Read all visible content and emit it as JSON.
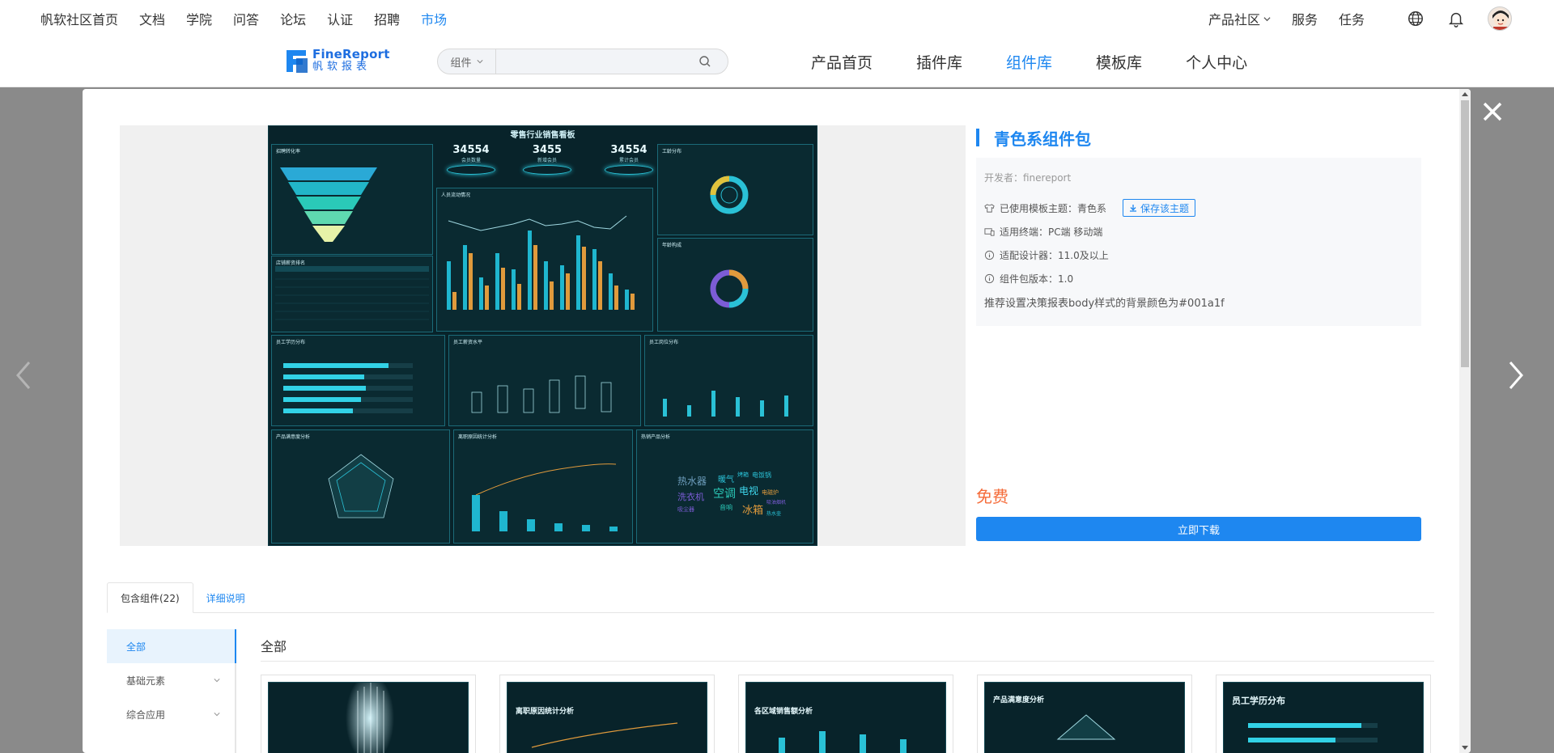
{
  "topnav": {
    "links": [
      "帆软社区首页",
      "文档",
      "学院",
      "问答",
      "论坛",
      "认证",
      "招聘",
      "市场"
    ],
    "right": {
      "community": "产品社区",
      "service": "服务",
      "task": "任务"
    }
  },
  "logo": {
    "en": "FineReport",
    "cn": "帆软报表"
  },
  "search": {
    "category": "组件",
    "placeholder": ""
  },
  "subnav": [
    "产品首页",
    "插件库",
    "组件库",
    "模板库",
    "个人中心"
  ],
  "preview": {
    "dash_title": "零售行业销售看板",
    "kpis": [
      {
        "num": "34554",
        "label": "会员数量"
      },
      {
        "num": "3455",
        "label": "新增会员"
      },
      {
        "num": "34554",
        "label": "累计会员"
      }
    ],
    "panels": [
      "招聘转化率",
      "人员流动情况",
      "工龄分布",
      "店铺薪资排名",
      "年龄构成",
      "员工学历分布",
      "员工薪资水平",
      "员工岗位分布",
      "产品满意度分析",
      "离职原因统计分析",
      "热销产品分析"
    ],
    "wordcloud": [
      "热水器",
      "暖气",
      "烤箱",
      "电饭锅",
      "洗衣机",
      "空调",
      "电视",
      "电磁炉",
      "冰箱",
      "音响",
      "吸尘器",
      "吸油烟机",
      "热水壶"
    ]
  },
  "info": {
    "title": "青色系组件包",
    "developer": "开发者：finereport",
    "theme": "已使用模板主题：青色系",
    "save_theme": "保存该主题",
    "terminal": "适用终端：PC端   移动端",
    "designer": "适配设计器：11.0及以上",
    "version": "组件包版本：1.0",
    "recommend": "推荐设置决策报表body样式的背景颜色为#001a1f",
    "price": "免费",
    "download": "立即下载"
  },
  "tabs": {
    "components": "包含组件(22)",
    "details": "详细说明"
  },
  "sidebar": {
    "all": "全部",
    "basic": "基础元素",
    "composite": "综合应用"
  },
  "main": {
    "heading": "全部"
  },
  "cards": [
    "",
    "离职原因统计分析",
    "各区域销售额分析",
    "产品满意度分析",
    "员工学历分布"
  ],
  "colors": {
    "accent": "#1e87f0",
    "price": "#f56c3a",
    "dash_bg": "#08232a",
    "cyan": "#2ac1d6",
    "orange": "#e09a3c"
  }
}
